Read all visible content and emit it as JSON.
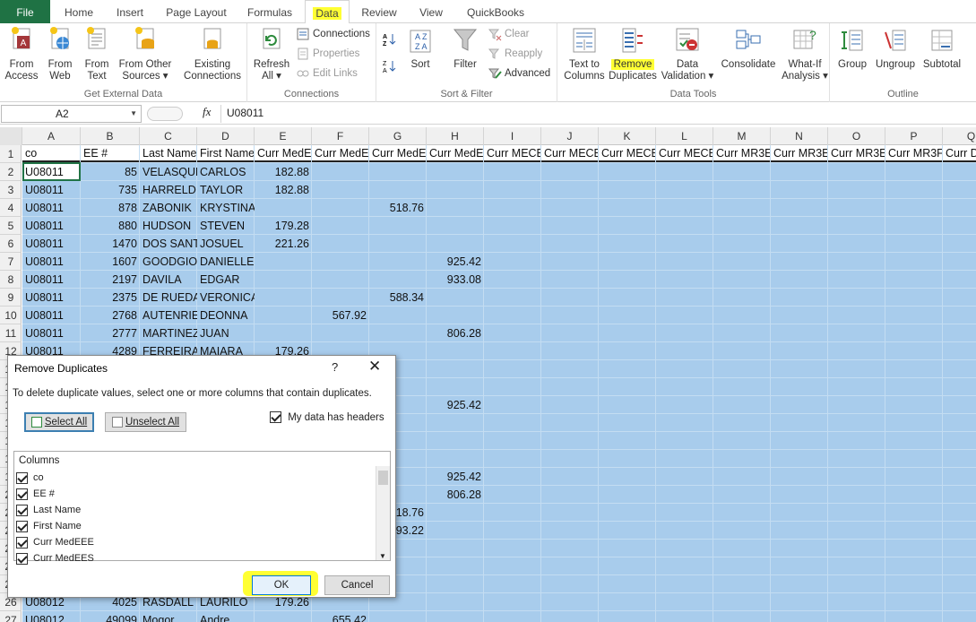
{
  "tabs": [
    "File",
    "Home",
    "Insert",
    "Page Layout",
    "Formulas",
    "Data",
    "Review",
    "View",
    "QuickBooks"
  ],
  "ribbon": {
    "get_external": {
      "from_access": [
        "From",
        "Access"
      ],
      "from_web": [
        "From",
        "Web"
      ],
      "from_text": [
        "From",
        "Text"
      ],
      "from_other": [
        "From Other",
        "Sources ▾"
      ],
      "existing": [
        "Existing",
        "Connections"
      ],
      "label": "Get External Data"
    },
    "connections": {
      "refresh": [
        "Refresh",
        "All ▾"
      ],
      "connections": "Connections",
      "properties": "Properties",
      "edit_links": "Edit Links",
      "label": "Connections"
    },
    "sort_filter": {
      "sort": "Sort",
      "filter": "Filter",
      "clear": "Clear",
      "reapply": "Reapply",
      "advanced": "Advanced",
      "label": "Sort & Filter"
    },
    "data_tools": {
      "text_to_columns": [
        "Text to",
        "Columns"
      ],
      "remove_duplicates": [
        "Remove",
        "Duplicates"
      ],
      "data_validation": [
        "Data",
        "Validation ▾"
      ],
      "consolidate": "Consolidate",
      "whatif": [
        "What-If",
        "Analysis ▾"
      ],
      "label": "Data Tools"
    },
    "outline": {
      "group": "Group",
      "ungroup": "Ungroup",
      "subtotal": "Subtotal",
      "label": "Outline"
    }
  },
  "formula_bar": {
    "name_box": "A2",
    "fx": "fx",
    "value": "U08011"
  },
  "columns": [
    "A",
    "B",
    "C",
    "D",
    "E",
    "F",
    "G",
    "H",
    "I",
    "J",
    "K",
    "L",
    "M",
    "N",
    "O",
    "P",
    "Q"
  ],
  "rows": [
    "1",
    "2",
    "3",
    "4",
    "5",
    "6",
    "7",
    "8",
    "9",
    "10",
    "11",
    "12",
    "13",
    "14",
    "15",
    "16",
    "17",
    "18",
    "19",
    "20",
    "21",
    "22",
    "23",
    "24",
    "25",
    "26",
    "27"
  ],
  "header_row": [
    "co",
    "EE #",
    "Last Name",
    "First Name",
    "Curr MedE",
    "Curr MedE",
    "Curr MedE",
    "Curr MedE",
    "Curr MECE",
    "Curr MECE",
    "Curr MECE",
    "Curr MECE",
    "Curr MR3E",
    "Curr MR3E",
    "Curr MR3E",
    "Curr MR3F",
    "Curr D"
  ],
  "data_rows": [
    {
      "co": "U08011",
      "ee": "85",
      "last": "VELASQUE",
      "first": "CARLOS",
      "e": "182.88",
      "f": "",
      "g": "",
      "h": ""
    },
    {
      "co": "U08011",
      "ee": "735",
      "last": "HARRELD",
      "first": "TAYLOR",
      "e": "182.88",
      "f": "",
      "g": "",
      "h": ""
    },
    {
      "co": "U08011",
      "ee": "878",
      "last": "ZABONIK",
      "first": "KRYSTINA",
      "e": "",
      "f": "",
      "g": "518.76",
      "h": ""
    },
    {
      "co": "U08011",
      "ee": "880",
      "last": "HUDSON",
      "first": "STEVEN",
      "e": "179.28",
      "f": "",
      "g": "",
      "h": ""
    },
    {
      "co": "U08011",
      "ee": "1470",
      "last": "DOS SANT",
      "first": "JOSUEL",
      "e": "221.26",
      "f": "",
      "g": "",
      "h": ""
    },
    {
      "co": "U08011",
      "ee": "1607",
      "last": "GOODGIO",
      "first": "DANIELLE",
      "e": "",
      "f": "",
      "g": "",
      "h": "925.42"
    },
    {
      "co": "U08011",
      "ee": "2197",
      "last": "DAVILA",
      "first": "EDGAR",
      "e": "",
      "f": "",
      "g": "",
      "h": "933.08"
    },
    {
      "co": "U08011",
      "ee": "2375",
      "last": "DE RUEDA",
      "first": "VERONICA",
      "e": "",
      "f": "",
      "g": "588.34",
      "h": ""
    },
    {
      "co": "U08011",
      "ee": "2768",
      "last": "AUTENRIE",
      "first": "DEONNA",
      "e": "",
      "f": "567.92",
      "g": "",
      "h": ""
    },
    {
      "co": "U08011",
      "ee": "2777",
      "last": "MARTINEZ",
      "first": "JUAN",
      "e": "",
      "f": "",
      "g": "",
      "h": "806.28"
    },
    {
      "co": "U08011",
      "ee": "4289",
      "last": "FERREIRA",
      "first": "MAIARA",
      "e": "179.26",
      "f": "",
      "g": "",
      "h": ""
    }
  ],
  "partial_cells": {
    "h15": "925.42",
    "h19": "925.42",
    "h20": "806.28",
    "g21": "18.76",
    "g22": "93.22",
    "row26": {
      "co": "U08012",
      "ee": "4025",
      "last": "RASDALL",
      "first": "LAURILO",
      "e": "179.26"
    },
    "row27": {
      "co": "U08012",
      "ee": "49099",
      "last": "Mogor",
      "first": "Andre",
      "f": "655.42"
    }
  },
  "dialog": {
    "title": "Remove Duplicates",
    "help": "?",
    "close": "✕",
    "description": "To delete duplicate values, select one or more columns that contain duplicates.",
    "select_all": "Select All",
    "unselect_all": "Unselect All",
    "has_headers": "My data has headers",
    "columns_title": "Columns",
    "columns": [
      "co",
      "EE #",
      "Last Name",
      "First Name",
      "Curr MedEEE",
      "Curr MedEES"
    ],
    "ok": "OK",
    "cancel": "Cancel"
  },
  "highlight_color": "#ffff33",
  "accent_color": "#1f7244",
  "selection_color": "#a8ccec"
}
